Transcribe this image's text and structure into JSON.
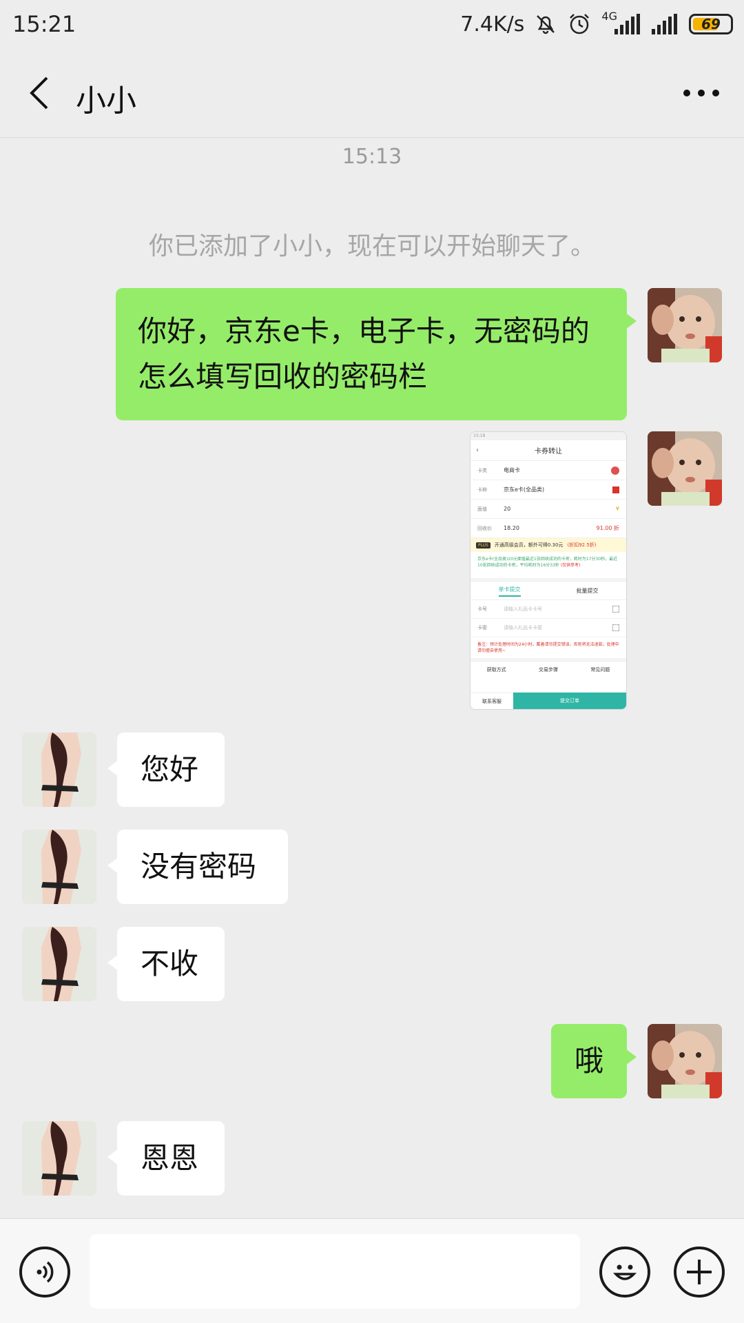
{
  "status_bar": {
    "time": "15:21",
    "net_speed": "7.4K/s",
    "network_type": "4G",
    "battery": "69",
    "icons": [
      "mute-bell-icon",
      "alarm-clock-icon",
      "signal-4g-icon",
      "signal-icon",
      "battery-icon"
    ],
    "battery_color": "#f5b400"
  },
  "header": {
    "title": "小小",
    "back_icon": "chevron-left-icon",
    "more_icon": "more-dots-icon"
  },
  "chat": {
    "time_label": "15:13",
    "system_note": "你已添加了小小，现在可以开始聊天了。",
    "messages": [
      {
        "from": "me",
        "text": "你好，京东e卡，电子卡，无密码的怎么填写回收的密码栏"
      },
      {
        "from": "me",
        "type": "image"
      },
      {
        "from": "other",
        "text": "您好"
      },
      {
        "from": "other",
        "text": "没有密码"
      },
      {
        "from": "other",
        "text": "不收"
      },
      {
        "from": "me",
        "text": "哦"
      },
      {
        "from": "other",
        "text": "恩恩"
      }
    ],
    "bubble_me_color": "#95ec69",
    "bubble_other_color": "#ffffff"
  },
  "shared_image": {
    "title": "卡券转让",
    "rows": [
      {
        "key": "卡类",
        "value": "电商卡"
      },
      {
        "key": "卡种",
        "value": "京东e卡(全品类)"
      },
      {
        "key": "面值",
        "value": "20"
      },
      {
        "key": "回收价",
        "value": "18.20",
        "extra": "91.00 折"
      }
    ],
    "plus_tag": "PLUS",
    "plus_text": "开通高级会员，额外可得0.30元",
    "plus_extra": "(折扣92.5折)",
    "note": "京东e卡(全品类)20元面值最近1张回收成功的卡密，耗时为17分30秒。最近10张回收成功的卡密，平均耗时为16分33秒",
    "note_extra": "(仅供参考)",
    "tabs": [
      "单卡提交",
      "批量提交"
    ],
    "inputs": [
      {
        "key": "卡号",
        "placeholder": "请输入礼品卡卡号"
      },
      {
        "key": "卡密",
        "placeholder": "请输入礼品卡卡密"
      }
    ],
    "warning": "备注：预计处理时间为24小时。戴着请勿提交错误，否则将无法退款。处理中请勿擅自使用~",
    "links": [
      "获取方式",
      "交易步骤",
      "常见问题"
    ],
    "service": "联系客服",
    "submit": "提交订单"
  },
  "input_bar": {
    "voice_icon": "voice-icon",
    "emoji_icon": "emoji-icon",
    "plus_icon": "plus-icon",
    "input_value": ""
  }
}
